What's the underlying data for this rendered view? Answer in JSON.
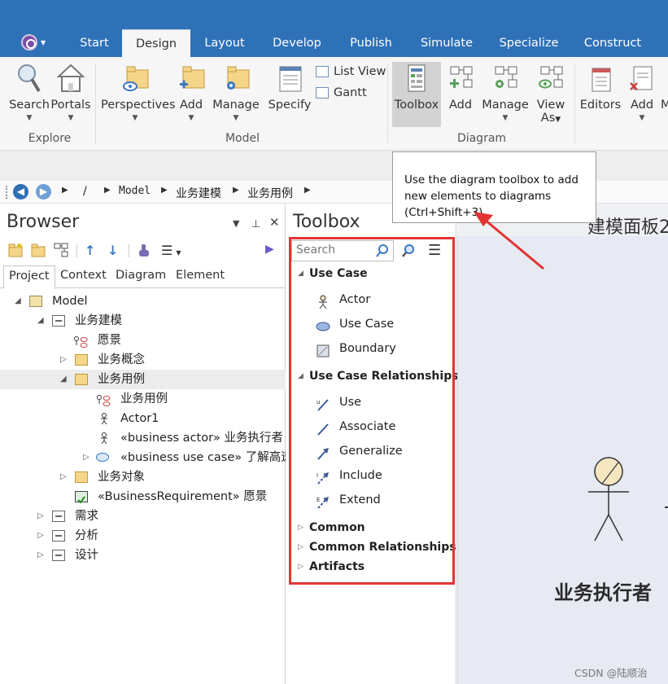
{
  "tabs": [
    "Start",
    "Design",
    "Layout",
    "Develop",
    "Publish",
    "Simulate",
    "Specialize",
    "Construct"
  ],
  "active_tab": "Design",
  "ribbon": {
    "explore": {
      "search": "Search",
      "portals": "Portals",
      "group": "Explore"
    },
    "model": {
      "perspectives": "Perspectives",
      "add": "Add",
      "manage": "Manage",
      "specify": "Specify",
      "list_view": "List View",
      "gantt": "Gantt",
      "group": "Model"
    },
    "diagram": {
      "toolbox": "Toolbox",
      "add": "Add",
      "manage": "Manage",
      "view": "View",
      "as": "As",
      "group": "Diagram"
    },
    "element": {
      "editors": "Editors",
      "add": "Add",
      "more": "M"
    }
  },
  "tooltip": {
    "line1": "Use the diagram toolbox to add",
    "line2": "new elements to diagrams",
    "line3": "(Ctrl+Shift+3)"
  },
  "breadcrumb": [
    "/",
    "Model",
    "业务建模",
    "业务用例"
  ],
  "browser": {
    "title": "Browser",
    "tabs": [
      "Project",
      "Context",
      "Diagram",
      "Element"
    ],
    "active_tab": "Project",
    "tree": [
      {
        "label": "Model",
        "icon": "package-root-icon",
        "expanded": true
      },
      {
        "label": "业务建模",
        "icon": "package-icon",
        "expanded": true
      },
      {
        "label": "愿景",
        "icon": "usecase-diagram-icon"
      },
      {
        "label": "业务概念",
        "icon": "folder-icon",
        "expanded": false
      },
      {
        "label": "业务用例",
        "icon": "folder-icon",
        "expanded": true,
        "selected": true
      },
      {
        "label": "业务用例",
        "icon": "usecase-diagram-icon"
      },
      {
        "label": "Actor1",
        "icon": "actor-icon"
      },
      {
        "label": "«business actor» 业务执行者",
        "icon": "actor-icon"
      },
      {
        "label": "«business use case» 了解高速",
        "icon": "usecase-ellipse-icon",
        "expanded": false
      },
      {
        "label": "业务对象",
        "icon": "folder-icon",
        "expanded": false
      },
      {
        "label": "«BusinessRequirement» 愿景",
        "icon": "requirement-icon"
      },
      {
        "label": "需求",
        "icon": "package-icon",
        "expanded": false
      },
      {
        "label": "分析",
        "icon": "package-icon",
        "expanded": false
      },
      {
        "label": "设计",
        "icon": "package-icon",
        "expanded": false
      }
    ]
  },
  "toolbox": {
    "title": "Toolbox",
    "search_placeholder": "Search",
    "sections": [
      {
        "title": "Use Case",
        "expanded": true,
        "items": [
          "Actor",
          "Use Case",
          "Boundary"
        ]
      },
      {
        "title": "Use Case Relationships",
        "expanded": true,
        "items": [
          "Use",
          "Associate",
          "Generalize",
          "Include",
          "Extend"
        ]
      },
      {
        "title": "Common",
        "expanded": false,
        "items": []
      },
      {
        "title": "Common Relationships",
        "expanded": false,
        "items": []
      },
      {
        "title": "Artifacts",
        "expanded": false,
        "items": []
      }
    ]
  },
  "diagram": {
    "title": "建模面板2",
    "actor_label": "业务执行者"
  },
  "watermark": "CSDN @陆顺治",
  "colors": {
    "ribbon_blue": "#2f71b7",
    "highlight_red": "#e23434",
    "canvas": "#e7eaf2"
  }
}
